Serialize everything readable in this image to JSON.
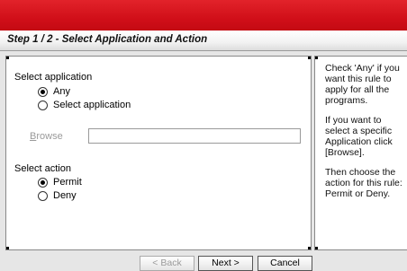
{
  "header": {
    "title": "Step 1 / 2 - Select Application and Action"
  },
  "application": {
    "label": "Select application",
    "options": [
      {
        "label": "Any",
        "checked": true
      },
      {
        "label": "Select application",
        "checked": false
      }
    ],
    "browse_label_prefix": "",
    "browse_label_underlined": "B",
    "browse_label_rest": "rowse",
    "browse_value": ""
  },
  "action": {
    "label": "Select action",
    "options": [
      {
        "label": "Permit",
        "checked": true
      },
      {
        "label": "Deny",
        "checked": false
      }
    ]
  },
  "help": {
    "para1": "Check 'Any' if you want this rule to apply for all the programs.",
    "para2": "If you want to select a specific Application click [Browse].",
    "para3": "Then choose the action for this rule: Permit or Deny."
  },
  "buttons": {
    "back": "< Back",
    "next": "Next >",
    "cancel": "Cancel"
  }
}
